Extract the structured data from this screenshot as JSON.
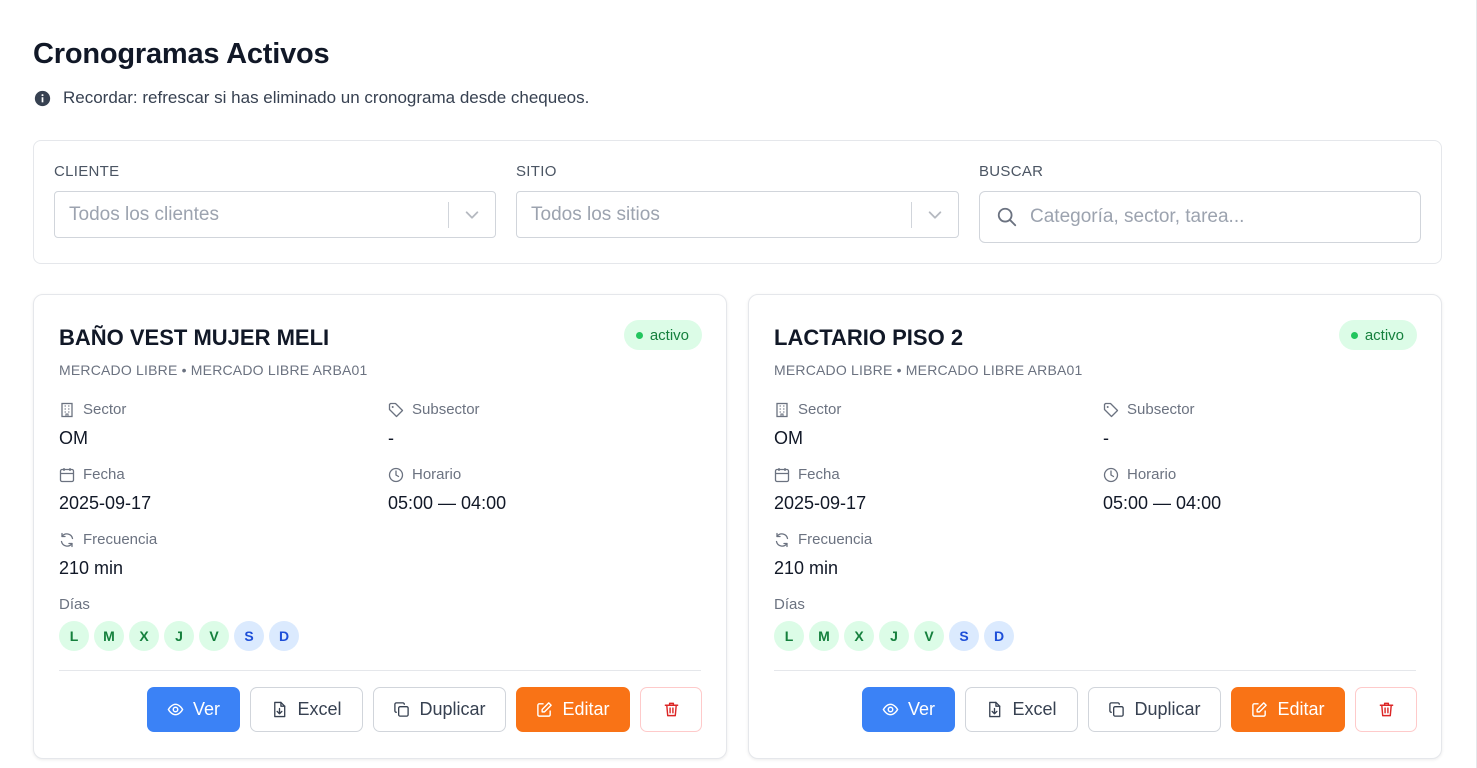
{
  "page": {
    "title": "Cronogramas Activos",
    "notice": "Recordar: refrescar si has eliminado un cronograma desde chequeos."
  },
  "filters": {
    "client_label": "CLIENTE",
    "client_placeholder": "Todos los clientes",
    "site_label": "SITIO",
    "site_placeholder": "Todos los sitios",
    "search_label": "BUSCAR",
    "search_placeholder": "Categoría, sector, tarea...",
    "search_value": ""
  },
  "labels": {
    "sector": "Sector",
    "subsector": "Subsector",
    "fecha": "Fecha",
    "horario": "Horario",
    "frecuencia": "Frecuencia",
    "dias": "Días"
  },
  "actions": {
    "view": "Ver",
    "excel": "Excel",
    "duplicate": "Duplicar",
    "edit": "Editar"
  },
  "cards": [
    {
      "title": "BAÑO VEST MUJER MELI",
      "status": "activo",
      "subtitle": "MERCADO LIBRE • MERCADO LIBRE ARBA01",
      "sector": "OM",
      "subsector": "-",
      "fecha": "2025-09-17",
      "horario": "05:00 — 04:00",
      "frecuencia": "210 min",
      "days": [
        "L",
        "M",
        "X",
        "J",
        "V",
        "S",
        "D"
      ]
    },
    {
      "title": "LACTARIO PISO 2",
      "status": "activo",
      "subtitle": "MERCADO LIBRE • MERCADO LIBRE ARBA01",
      "sector": "OM",
      "subsector": "-",
      "fecha": "2025-09-17",
      "horario": "05:00 — 04:00",
      "frecuencia": "210 min",
      "days": [
        "L",
        "M",
        "X",
        "J",
        "V",
        "S",
        "D"
      ]
    }
  ],
  "colors": {
    "primary": "#3b82f6",
    "edit": "#f97316",
    "danger": "#dc2626",
    "active_badge_bg": "#dcfce7",
    "active_badge_text": "#15803d",
    "weekday_bg": "#dcfce7",
    "weekend_bg": "#dbeafe"
  },
  "icons": {
    "notice": "info-circle-icon",
    "select_chevron": "chevron-down-icon",
    "search": "search-icon",
    "sector": "building-icon",
    "subsector": "tag-icon",
    "fecha": "calendar-icon",
    "horario": "clock-icon",
    "frecuencia": "refresh-icon",
    "view": "eye-icon",
    "excel": "file-download-icon",
    "duplicate": "copy-icon",
    "edit": "edit-icon",
    "delete": "trash-icon"
  }
}
